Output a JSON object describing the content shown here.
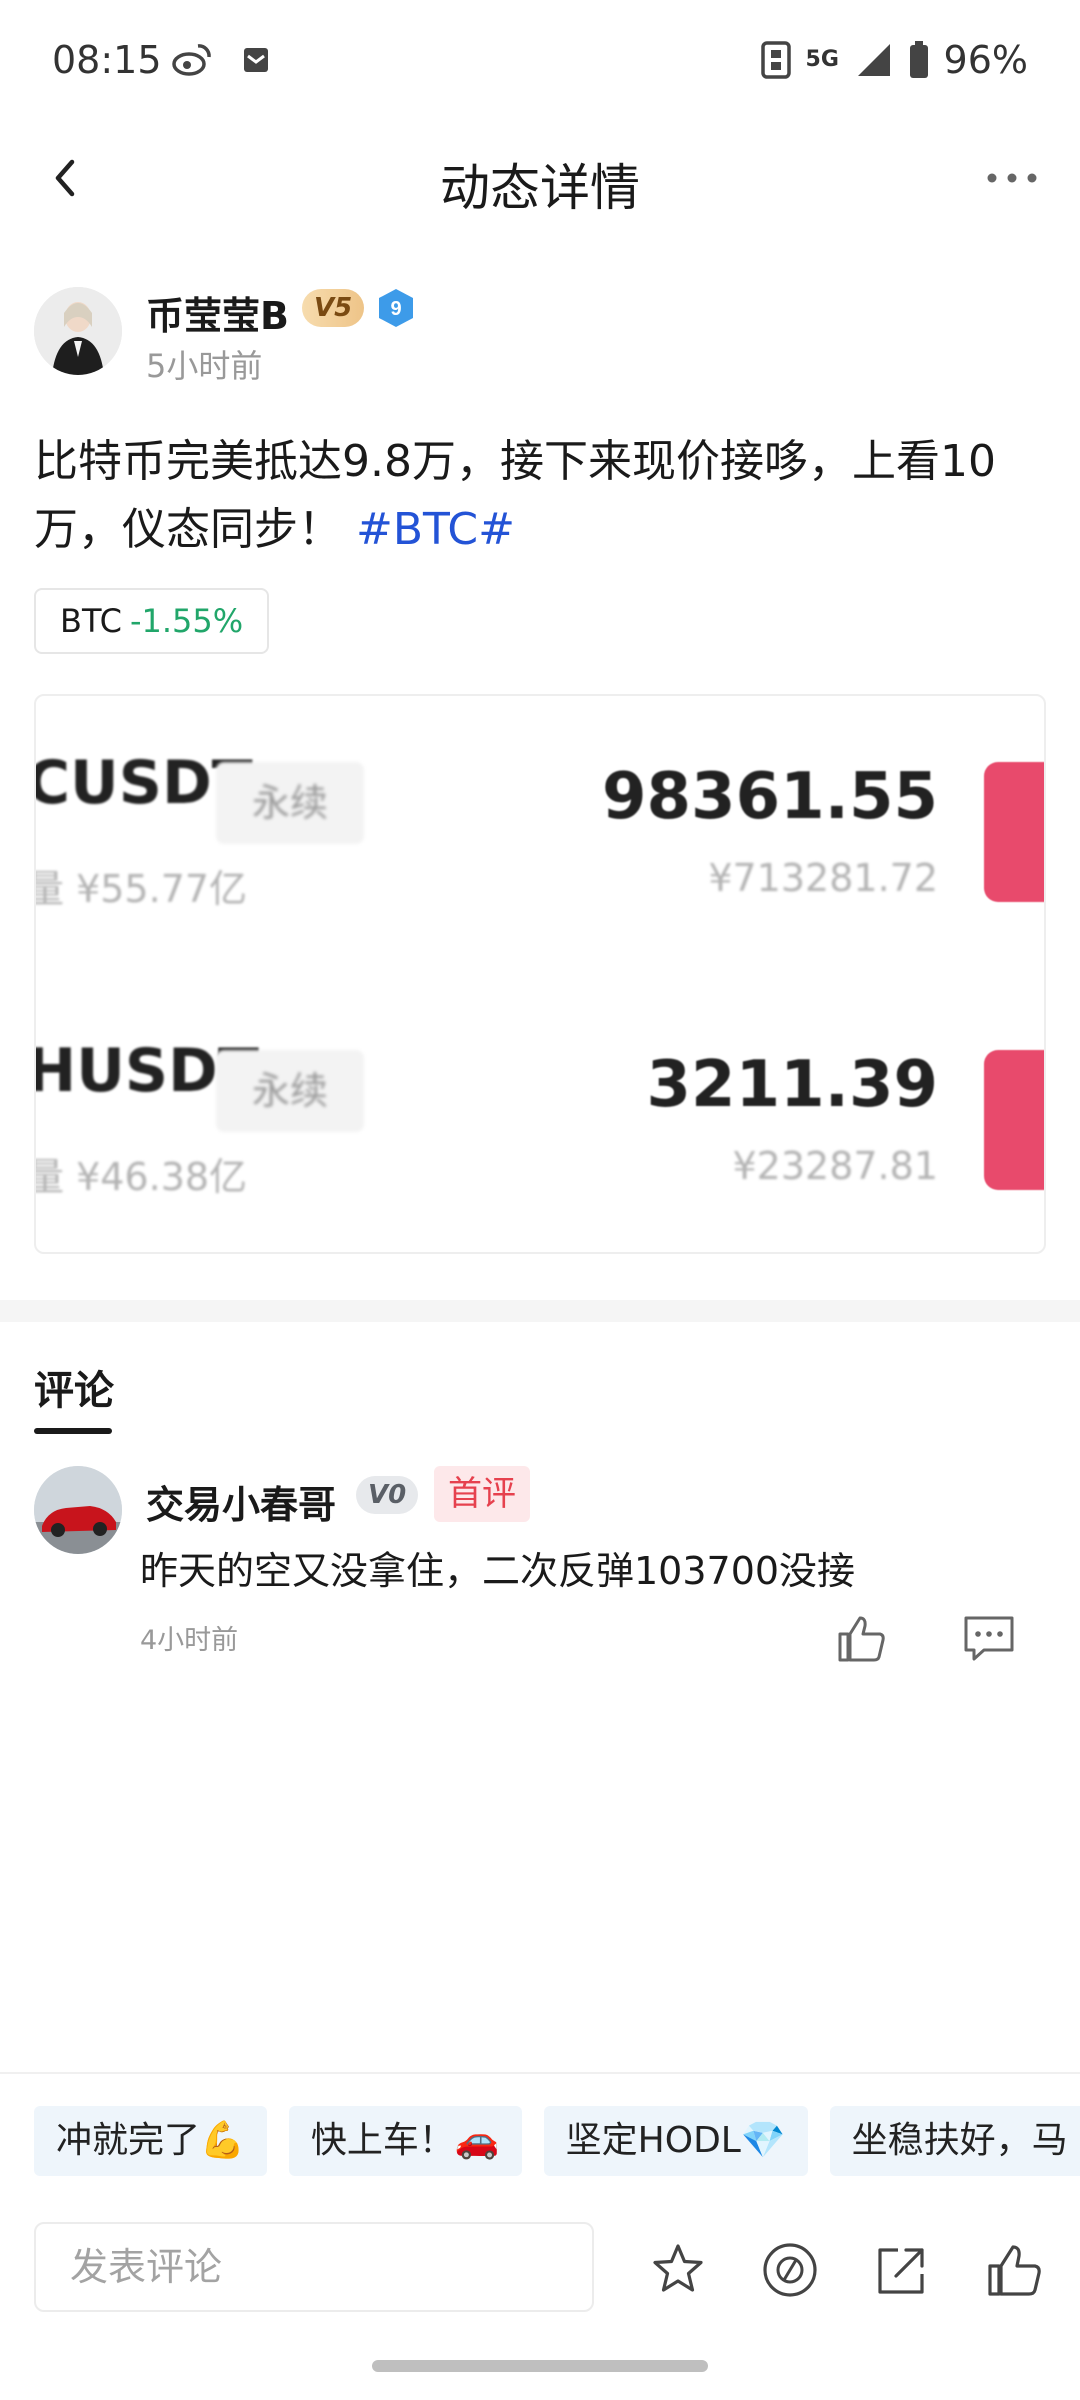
{
  "status_bar": {
    "time": "08:15",
    "network": "5G",
    "battery": "96%"
  },
  "header": {
    "title": "动态详情"
  },
  "post": {
    "author": {
      "name": "币莹莹B",
      "vip_level": "V5",
      "level_badge": "9"
    },
    "time_ago": "5小时前",
    "text": "比特币完美抵达9.8万，接下来现价接哆，上看10万，仪态同步！ ",
    "hashtag": "#BTC#",
    "coin_tag": {
      "symbol": "BTC",
      "change": "-1.55%"
    },
    "market_image": {
      "rows": [
        {
          "pair": "CUSDT",
          "type": "永续",
          "volume": "量 ¥55.77亿",
          "price": "98361.55",
          "price_cny": "¥713281.72"
        },
        {
          "pair": "HUSDT",
          "type": "永续",
          "volume": "量 ¥46.38亿",
          "price": "3211.39",
          "price_cny": "¥23287.81"
        }
      ]
    }
  },
  "comments_section": {
    "tab_label": "评论",
    "comments": [
      {
        "user": "交易小春哥",
        "vip_level": "V0",
        "badge": "首评",
        "text": "昨天的空又没拿住，二次反弹103700没接",
        "time_ago": "4小时前"
      }
    ]
  },
  "quick_replies": [
    "冲就完了💪",
    "快上车！🚗",
    "坚定HODL💎",
    "坐稳扶好，马"
  ],
  "bottom_bar": {
    "comment_placeholder": "发表评论"
  }
}
